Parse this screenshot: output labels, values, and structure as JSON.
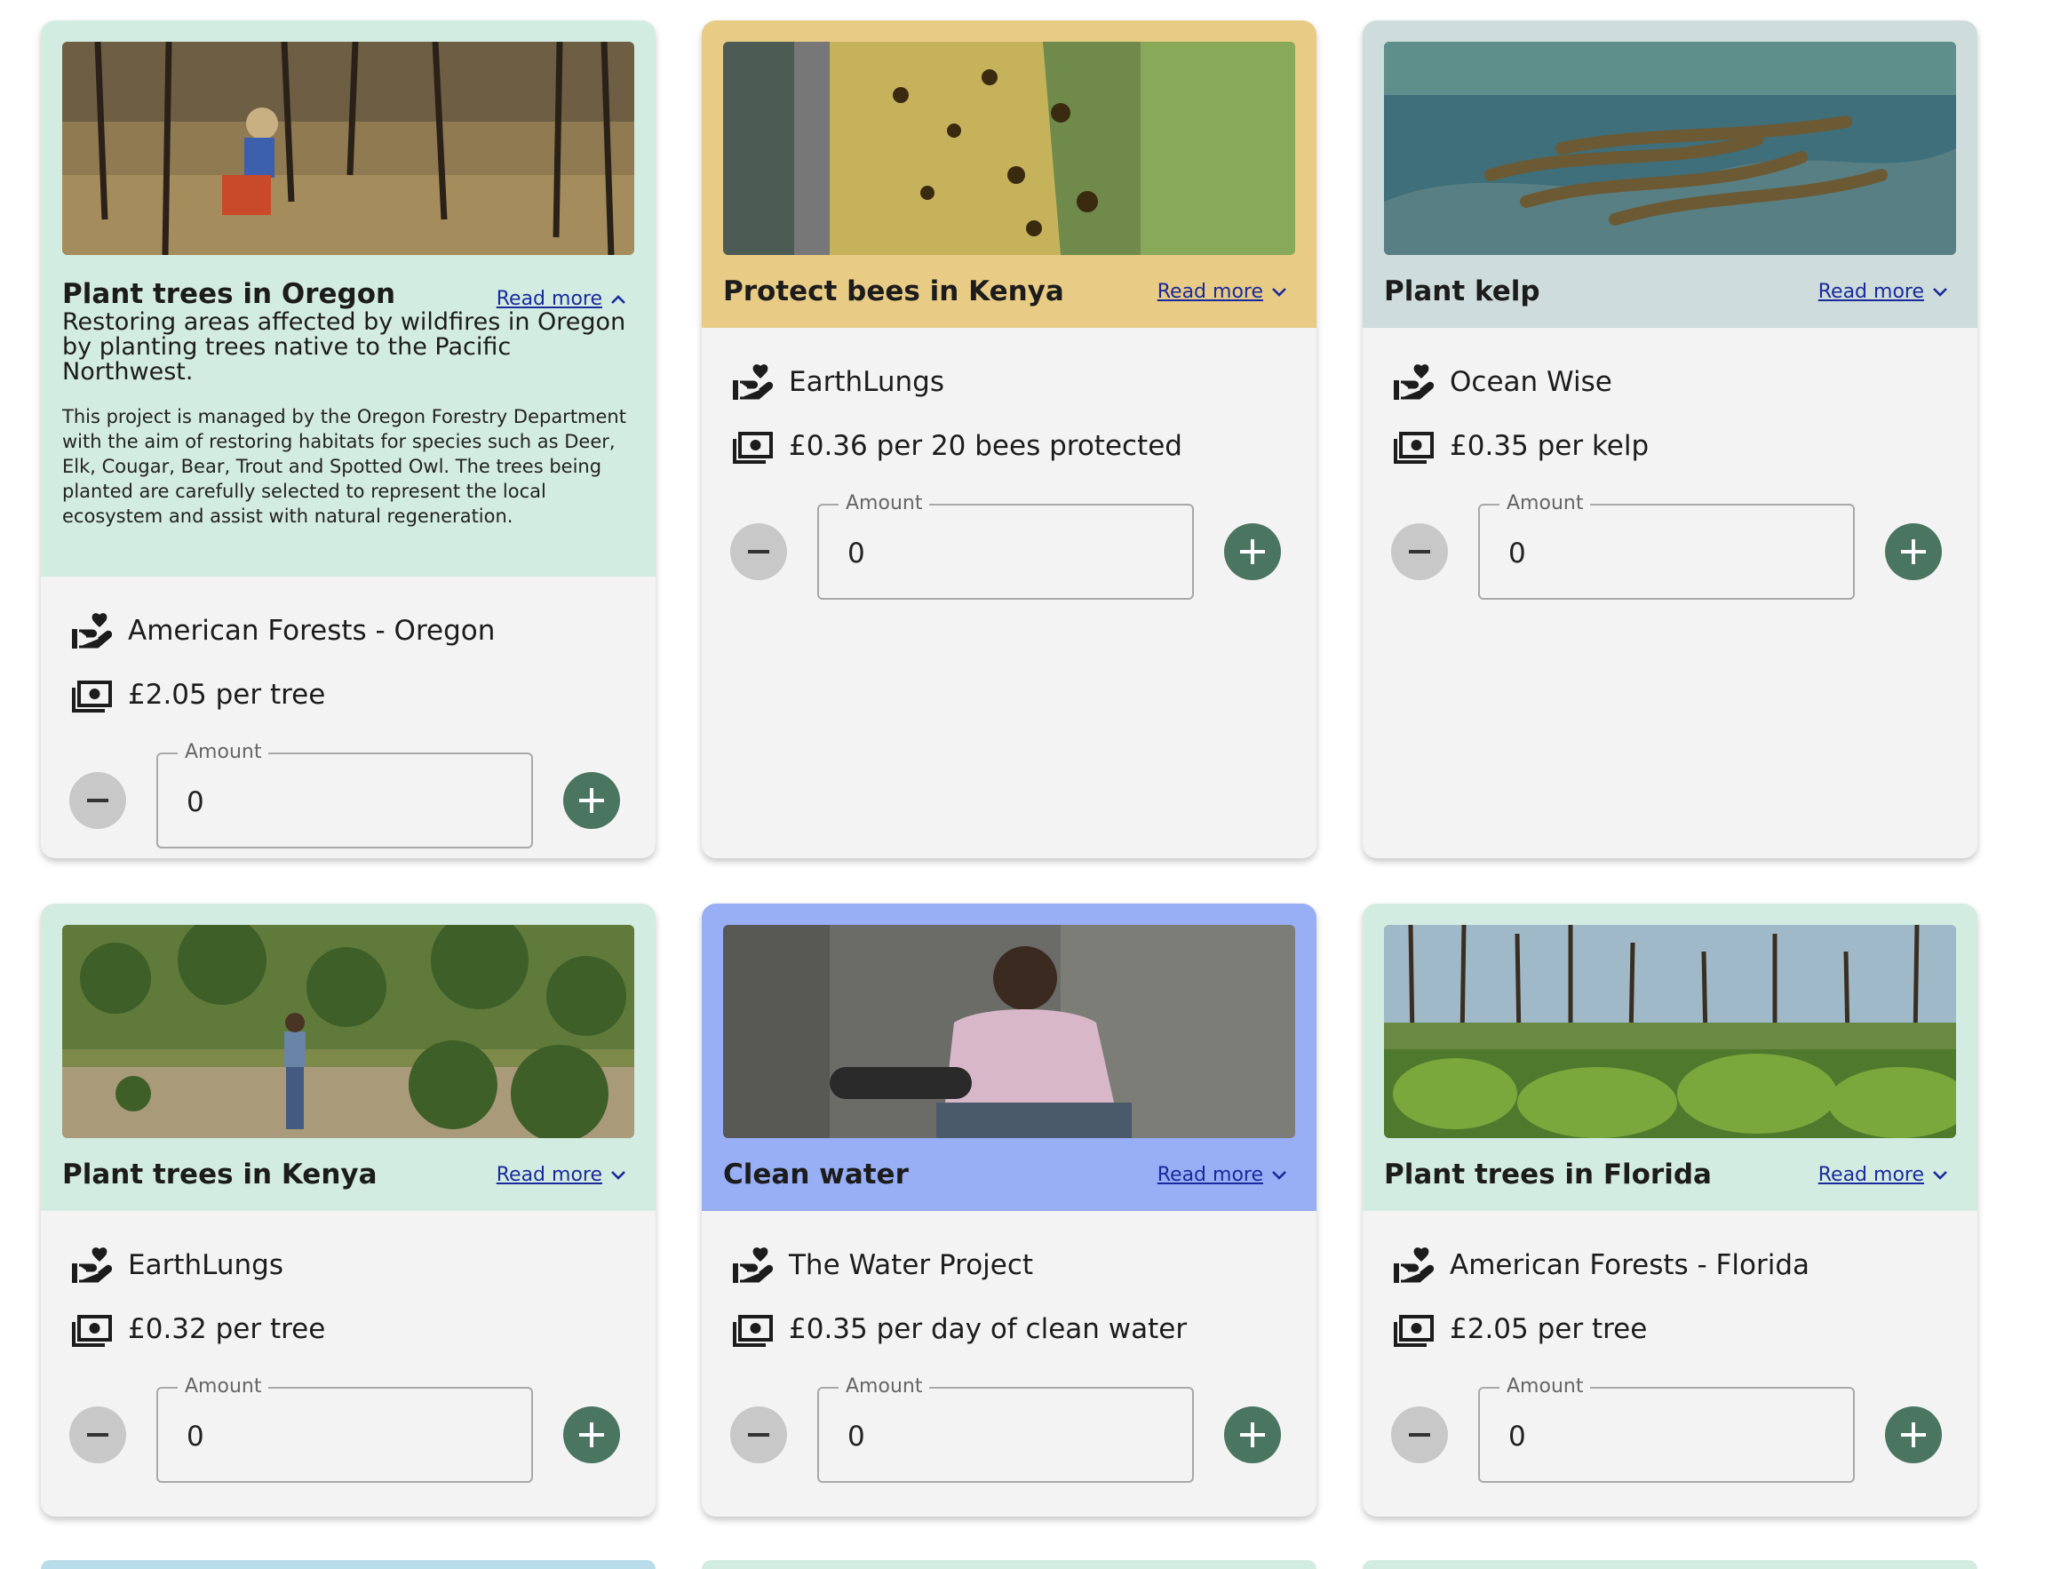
{
  "colors": {
    "card_bg": "#f3f3f3",
    "trees_head": "#d3ece1",
    "bees_head": "#e8cb84",
    "kelp_head": "#cedcdc",
    "water_head": "#98aef5",
    "plus_button": "#4a7560",
    "minus_button": "#c8c8c8",
    "link": "#1a2a9c"
  },
  "icons": {
    "organisation": "hand-heart-icon",
    "price": "money-icon",
    "read_more_collapsed": "chevron-down-icon",
    "read_more_expanded": "chevron-up-icon",
    "decrease": "minus-icon",
    "increase": "plus-icon"
  },
  "cards": [
    {
      "title": "Plant trees in Oregon",
      "read_more": "Read more",
      "expanded": true,
      "summary": "Restoring areas affected by wildfires in Oregon by planting trees native to the Pacific Northwest.",
      "details": "This project is managed by the Oregon Forestry Department with the aim of restoring habitats for species such as Deer, Elk, Cougar, Bear, Trout and Spotted Owl. The trees being planted are carefully selected to represent the local ecosystem and assist with natural regeneration.",
      "organisation": "American Forests - Oregon",
      "price": "£2.05 per tree",
      "amount_label": "Amount",
      "amount_value": "0"
    },
    {
      "title": "Protect bees in Kenya",
      "read_more": "Read more",
      "expanded": false,
      "organisation": "EarthLungs",
      "price": "£0.36 per 20 bees protected",
      "amount_label": "Amount",
      "amount_value": "0"
    },
    {
      "title": "Plant kelp",
      "read_more": "Read more",
      "expanded": false,
      "organisation": "Ocean Wise",
      "price": "£0.35 per kelp",
      "amount_label": "Amount",
      "amount_value": "0"
    },
    {
      "title": "Plant trees in Kenya",
      "read_more": "Read more",
      "expanded": false,
      "organisation": "EarthLungs",
      "price": "£0.32 per tree",
      "amount_label": "Amount",
      "amount_value": "0"
    },
    {
      "title": "Clean water",
      "read_more": "Read more",
      "expanded": false,
      "organisation": "The Water Project",
      "price": "£0.35 per day of clean water",
      "amount_label": "Amount",
      "amount_value": "0"
    },
    {
      "title": "Plant trees in Florida",
      "read_more": "Read more",
      "expanded": false,
      "organisation": "American Forests - Florida",
      "price": "£2.05 per tree",
      "amount_label": "Amount",
      "amount_value": "0"
    }
  ]
}
